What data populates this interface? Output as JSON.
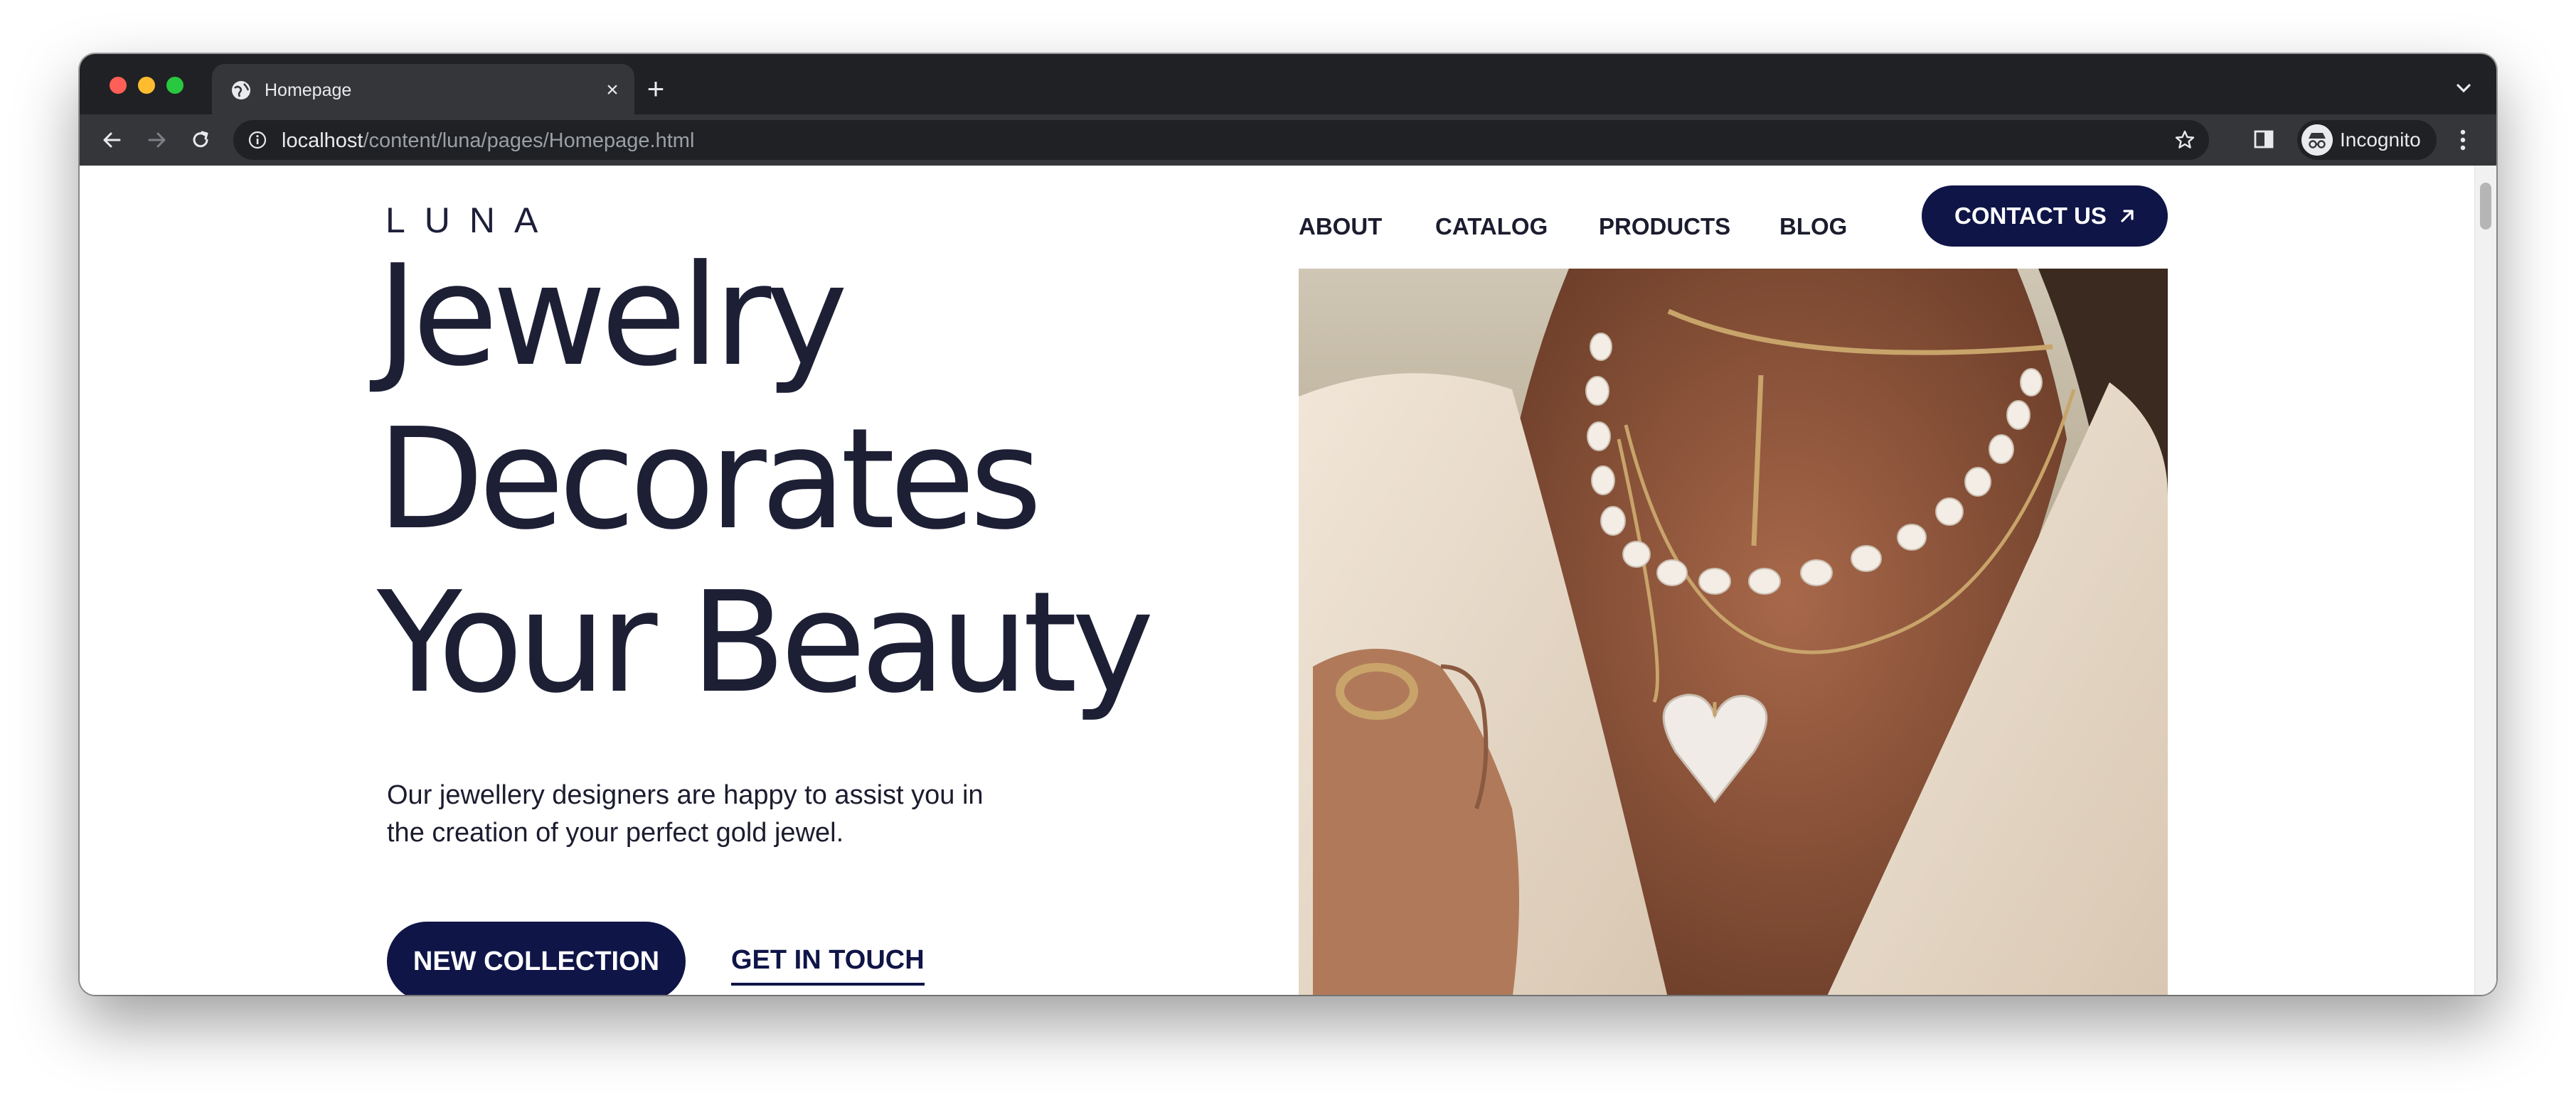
{
  "browser": {
    "tab": {
      "title": "Homepage",
      "favicon": "globe-icon"
    },
    "address_bar": {
      "host": "localhost",
      "path": "/content/luna/pages/Homepage.html"
    },
    "profile_label": "Incognito",
    "icons": {
      "back": "arrow-left-icon",
      "forward": "arrow-right-icon",
      "reload": "reload-icon",
      "site_info": "info-icon",
      "bookmark": "star-icon",
      "side_panel": "side-panel-icon",
      "menu": "kebab-menu-icon",
      "new_tab": "plus-icon",
      "tab_search": "chevron-down-icon"
    }
  },
  "site": {
    "logo": "LUNA",
    "nav": {
      "about": "ABOUT",
      "catalog": "CATALOG",
      "products": "PRODUCTS",
      "blog": "BLOG"
    },
    "contact_button": "CONTACT US",
    "hero": {
      "headline": [
        "Jewelry",
        "Decorates",
        "Your Beauty"
      ],
      "subtext": "Our jewellery designers are happy to assist you in the creation of your perfect gold jewel.",
      "cta_primary": "NEW COLLECTION",
      "cta_secondary": "GET IN TOUCH"
    }
  },
  "colors": {
    "brand_navy": "#0f1547",
    "headline_text": "#1d1f35",
    "chrome_dark": "#202124",
    "chrome_toolbar": "#35363a"
  }
}
